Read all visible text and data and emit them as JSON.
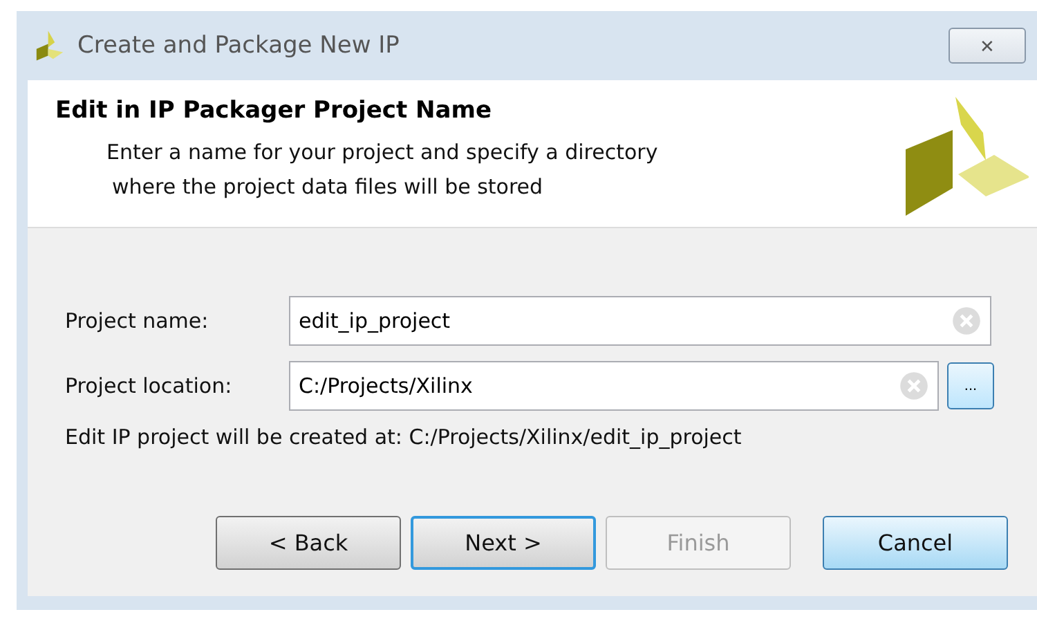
{
  "window": {
    "title": "Create and Package New IP",
    "close": "✕"
  },
  "header": {
    "title": "Edit in IP Packager Project Name",
    "description_lines": [
      "Enter a name for your project and specify a directory",
      "where the project data files will be stored"
    ]
  },
  "fields": [
    {
      "label": "Project name:",
      "value": "edit_ip_project",
      "browse": false
    },
    {
      "label": "Project location:",
      "value": "C:/Projects/Xilinx",
      "browse": true,
      "browse_label": "..."
    }
  ],
  "info": "Edit IP project will be created at: C:/Projects/Xilinx/edit_ip_project",
  "buttons": [
    {
      "label": "< Back",
      "disabled": false,
      "default": false,
      "hovered": false
    },
    {
      "label": "Next >",
      "disabled": false,
      "default": true,
      "hovered": false
    },
    {
      "label": "Finish",
      "disabled": true,
      "default": false,
      "hovered": false
    },
    {
      "label": "Cancel",
      "disabled": false,
      "default": false,
      "hovered": true
    }
  ]
}
